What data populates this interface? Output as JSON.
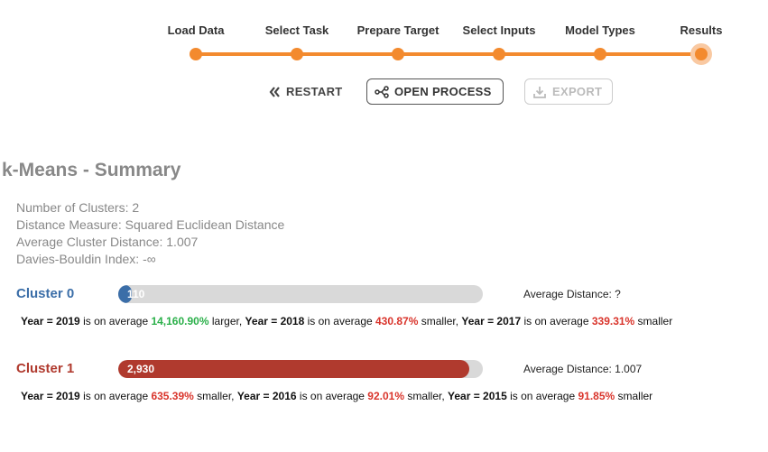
{
  "wizard": {
    "steps": [
      "Load Data",
      "Select Task",
      "Prepare Target",
      "Select Inputs",
      "Model Types",
      "Results"
    ],
    "current": "Results",
    "accent": "#f38a2e"
  },
  "actions": {
    "restart": "RESTART",
    "open_process": "OPEN PROCESS",
    "export": "EXPORT"
  },
  "summary": {
    "title": "k-Means - Summary",
    "lines": [
      "Number of Clusters: 2",
      "Distance Measure: Squared Euclidean Distance",
      "Average Cluster Distance: 1.007",
      "Davies-Bouldin Index: -∞"
    ]
  },
  "clusters": [
    {
      "name": "Cluster 0",
      "color": "#3b6ea8",
      "count_label": "110",
      "share": 0.036,
      "avg_distance": "Average Distance: ?",
      "facts": [
        {
          "attr": "Year = 2019",
          "mid": " is on average ",
          "pct": "14,160.90%",
          "dir": " larger",
          "sign": "pos"
        },
        {
          "attr": "Year = 2018",
          "mid": " is on average ",
          "pct": "430.87%",
          "dir": " smaller",
          "sign": "neg"
        },
        {
          "attr": "Year = 2017",
          "mid": " is on average ",
          "pct": "339.31%",
          "dir": " smaller",
          "sign": "neg"
        }
      ]
    },
    {
      "name": "Cluster 1",
      "color": "#b03a2e",
      "count_label": "2,930",
      "share": 0.964,
      "avg_distance": "Average Distance: 1.007",
      "facts": [
        {
          "attr": "Year = 2019",
          "mid": " is on average ",
          "pct": "635.39%",
          "dir": " smaller",
          "sign": "neg"
        },
        {
          "attr": "Year = 2016",
          "mid": " is on average ",
          "pct": "92.01%",
          "dir": " smaller",
          "sign": "neg"
        },
        {
          "attr": "Year = 2015",
          "mid": " is on average ",
          "pct": "91.85%",
          "dir": " smaller",
          "sign": "neg"
        }
      ]
    }
  ]
}
